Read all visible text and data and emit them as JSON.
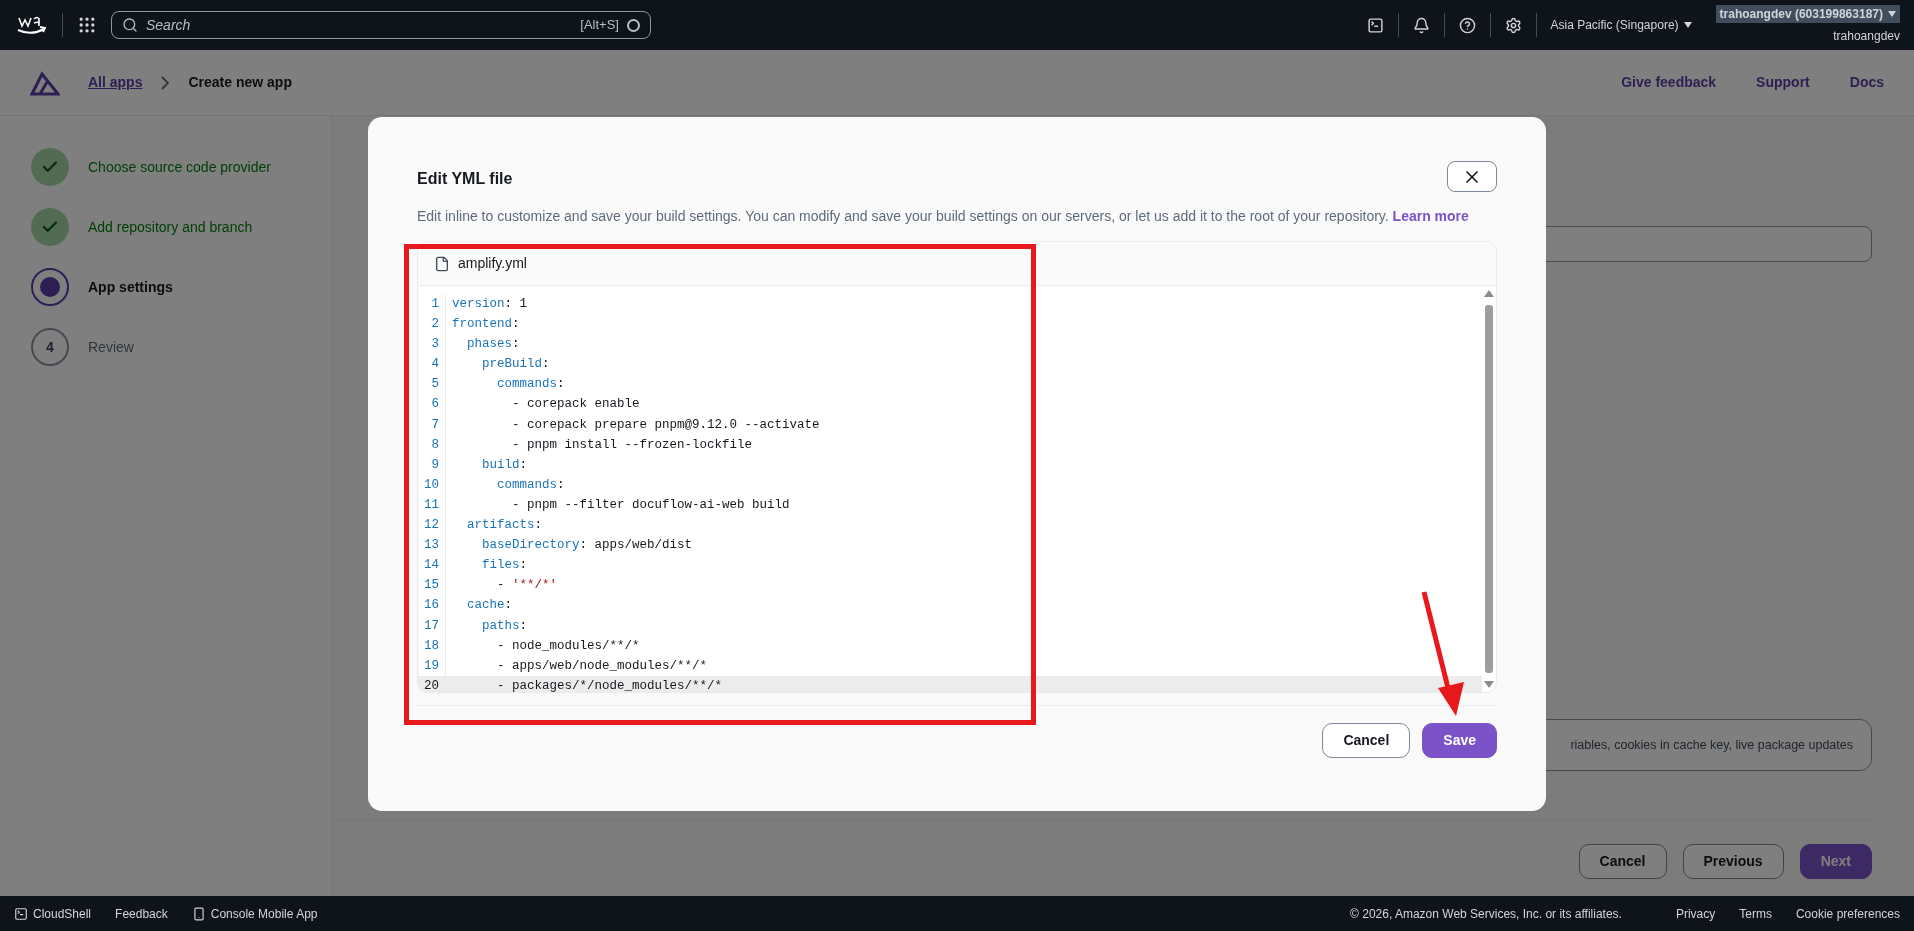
{
  "top_bar": {
    "search": {
      "placeholder": "Search",
      "shortcut": "[Alt+S]"
    },
    "region": "Asia Pacific (Singapore)",
    "account": "trahoangdev (603199863187)",
    "user": "trahoangdev"
  },
  "header": {
    "breadcrumbs": [
      {
        "label": "All apps",
        "kind": "link"
      },
      {
        "label": "Create new app",
        "kind": "current"
      }
    ],
    "links": [
      "Give feedback",
      "Support",
      "Docs"
    ]
  },
  "steps": [
    {
      "label": "Choose source code provider",
      "kind": "complete"
    },
    {
      "label": "Add repository and branch",
      "kind": "complete"
    },
    {
      "label": "App settings",
      "kind": "current"
    },
    {
      "label": "Review",
      "kind": "pending",
      "number": "4"
    }
  ],
  "background": {
    "info_text": "riables, cookies in cache key, live package updates",
    "buttons": [
      {
        "label": "Cancel",
        "kind": "normal"
      },
      {
        "label": "Previous",
        "kind": "normal"
      },
      {
        "label": "Next",
        "kind": "primary"
      }
    ]
  },
  "modal": {
    "title": "Edit YML file",
    "description": "Edit inline to customize and save your build settings. You can modify and save your build settings on our servers, or let us add it to the root of your repository.",
    "link": "Learn more",
    "file_name": "amplify.yml",
    "lines": [
      {
        "number": "1",
        "selected": false,
        "tokens": [
          {
            "kind": "key",
            "text": "version"
          },
          {
            "kind": "plain",
            "text": ": 1"
          }
        ]
      },
      {
        "number": "2",
        "selected": false,
        "tokens": [
          {
            "kind": "key",
            "text": "frontend"
          },
          {
            "kind": "plain",
            "text": ":"
          }
        ]
      },
      {
        "number": "3",
        "selected": false,
        "tokens": [
          {
            "kind": "key",
            "text": "  phases"
          },
          {
            "kind": "plain",
            "text": ":"
          }
        ]
      },
      {
        "number": "4",
        "selected": false,
        "tokens": [
          {
            "kind": "key",
            "text": "    preBuild"
          },
          {
            "kind": "plain",
            "text": ":"
          }
        ]
      },
      {
        "number": "5",
        "selected": false,
        "tokens": [
          {
            "kind": "key",
            "text": "      commands"
          },
          {
            "kind": "plain",
            "text": ":"
          }
        ]
      },
      {
        "number": "6",
        "selected": false,
        "tokens": [
          {
            "kind": "plain",
            "text": "        - corepack enable"
          }
        ]
      },
      {
        "number": "7",
        "selected": false,
        "tokens": [
          {
            "kind": "plain",
            "text": "        - corepack prepare pnpm@9.12.0 --activate"
          }
        ]
      },
      {
        "number": "8",
        "selected": false,
        "tokens": [
          {
            "kind": "plain",
            "text": "        - pnpm install --frozen-lockfile"
          }
        ]
      },
      {
        "number": "9",
        "selected": false,
        "tokens": [
          {
            "kind": "key",
            "text": "    build"
          },
          {
            "kind": "plain",
            "text": ":"
          }
        ]
      },
      {
        "number": "10",
        "selected": false,
        "tokens": [
          {
            "kind": "key",
            "text": "      commands"
          },
          {
            "kind": "plain",
            "text": ":"
          }
        ]
      },
      {
        "number": "11",
        "selected": false,
        "tokens": [
          {
            "kind": "plain",
            "text": "        - pnpm --filter docuflow-ai-web build"
          }
        ]
      },
      {
        "number": "12",
        "selected": false,
        "tokens": [
          {
            "kind": "key",
            "text": "  artifacts"
          },
          {
            "kind": "plain",
            "text": ":"
          }
        ]
      },
      {
        "number": "13",
        "selected": false,
        "tokens": [
          {
            "kind": "key",
            "text": "    baseDirectory"
          },
          {
            "kind": "plain",
            "text": ": apps/web/dist"
          }
        ]
      },
      {
        "number": "14",
        "selected": false,
        "tokens": [
          {
            "kind": "key",
            "text": "    files"
          },
          {
            "kind": "plain",
            "text": ":"
          }
        ]
      },
      {
        "number": "15",
        "selected": false,
        "tokens": [
          {
            "kind": "plain",
            "text": "      - "
          },
          {
            "kind": "string",
            "text": "'**/*'"
          }
        ]
      },
      {
        "number": "16",
        "selected": false,
        "tokens": [
          {
            "kind": "key",
            "text": "  cache"
          },
          {
            "kind": "plain",
            "text": ":"
          }
        ]
      },
      {
        "number": "17",
        "selected": false,
        "tokens": [
          {
            "kind": "key",
            "text": "    paths"
          },
          {
            "kind": "plain",
            "text": ":"
          }
        ]
      },
      {
        "number": "18",
        "selected": false,
        "tokens": [
          {
            "kind": "plain",
            "text": "      - node_modules/**/*"
          }
        ]
      },
      {
        "number": "19",
        "selected": false,
        "tokens": [
          {
            "kind": "plain",
            "text": "      - apps/web/node_modules/**/*"
          }
        ]
      },
      {
        "number": "20",
        "selected": true,
        "tokens": [
          {
            "kind": "plain",
            "text": "      - packages/*/node_modules/**/*"
          }
        ]
      }
    ],
    "buttons": [
      {
        "label": "Cancel",
        "kind": "normal"
      },
      {
        "label": "Save",
        "kind": "primary"
      }
    ]
  },
  "footer": {
    "left": [
      {
        "label": "CloudShell",
        "kind": "terminal"
      },
      {
        "label": "Feedback",
        "kind": "plain"
      },
      {
        "label": "Console Mobile App",
        "kind": "phone"
      }
    ],
    "copyright": "© 2026, Amazon Web Services, Inc. or its affiliates.",
    "links": [
      "Privacy",
      "Terms",
      "Cookie preferences"
    ]
  }
}
